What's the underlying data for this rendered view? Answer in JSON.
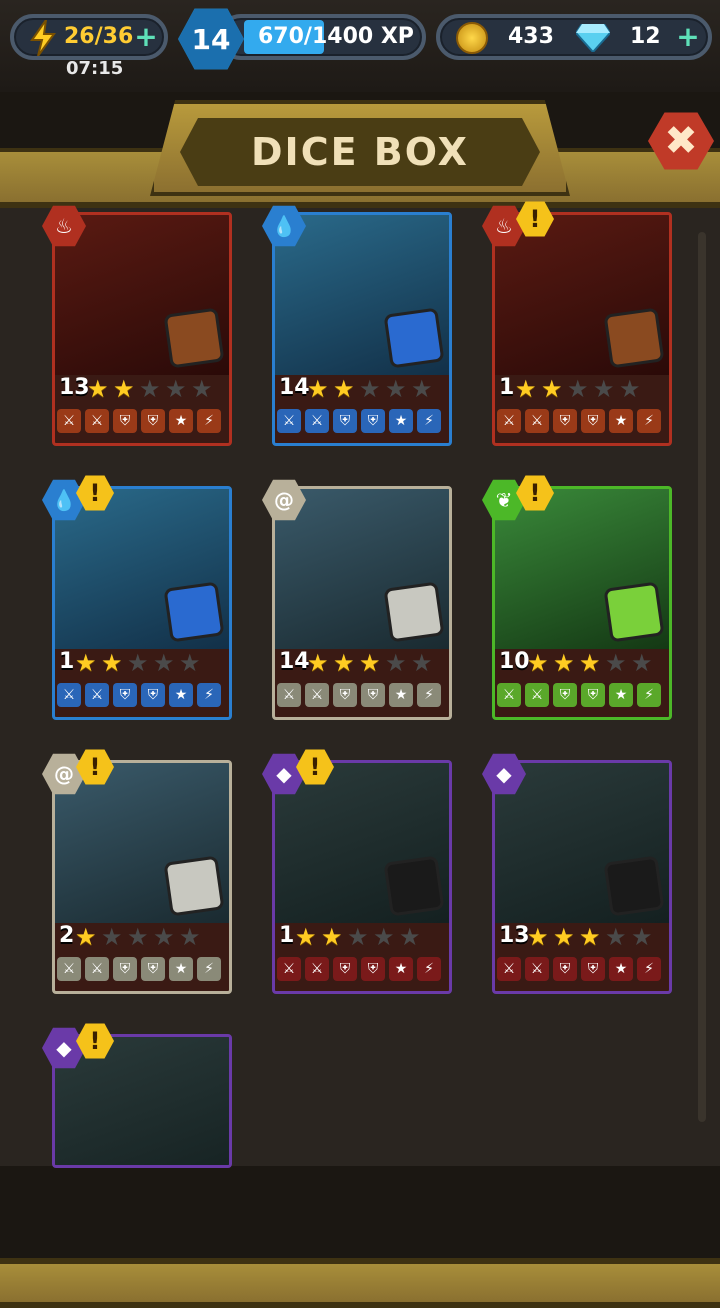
{
  "topbar": {
    "energy": "26/36",
    "timer": "07:15",
    "level": "14",
    "xp": "670/1400 XP",
    "coins": "433",
    "gems": "12"
  },
  "title": "DICE BOX",
  "colors": {
    "fire": "#b03020",
    "water": "#2a7fd0",
    "earth": "#c8c0a8",
    "nature": "#4cb828",
    "shadow": "#6a3aa8"
  },
  "cards": [
    {
      "level": "13",
      "stars": 2,
      "element": "fire",
      "warn": false
    },
    {
      "level": "14",
      "stars": 2,
      "element": "water",
      "warn": false
    },
    {
      "level": "1",
      "stars": 2,
      "element": "fire",
      "warn": true
    },
    {
      "level": "1",
      "stars": 2,
      "element": "water",
      "warn": true
    },
    {
      "level": "14",
      "stars": 3,
      "element": "earth",
      "warn": false
    },
    {
      "level": "10",
      "stars": 3,
      "element": "nature",
      "warn": true
    },
    {
      "level": "2",
      "stars": 1,
      "element": "earth",
      "warn": true
    },
    {
      "level": "1",
      "stars": 2,
      "element": "shadow",
      "warn": true
    },
    {
      "level": "13",
      "stars": 3,
      "element": "shadow",
      "warn": false
    },
    {
      "level": "",
      "stars": 0,
      "element": "shadow",
      "warn": true
    }
  ]
}
